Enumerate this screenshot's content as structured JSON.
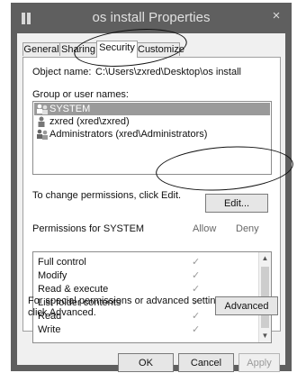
{
  "window": {
    "title": "os install Properties",
    "close_glyph": "×"
  },
  "tabs": [
    {
      "label": "General"
    },
    {
      "label": "Sharing"
    },
    {
      "label": "Security"
    },
    {
      "label": "Customize"
    }
  ],
  "object": {
    "label": "Object name:",
    "value": "C:\\Users\\zxred\\Desktop\\os install"
  },
  "groups": {
    "label": "Group or user names:",
    "users": [
      {
        "name": "SYSTEM"
      },
      {
        "name": "zxred (xred\\zxred)"
      },
      {
        "name": "Administrators (xred\\Administrators)"
      }
    ]
  },
  "change": {
    "text": "To change permissions, click Edit.",
    "edit_label": "Edit..."
  },
  "permissions": {
    "title": "Permissions for SYSTEM",
    "allow_header": "Allow",
    "deny_header": "Deny",
    "rows": [
      {
        "name": "Full control",
        "allow": "✓"
      },
      {
        "name": "Modify",
        "allow": "✓"
      },
      {
        "name": "Read & execute",
        "allow": "✓"
      },
      {
        "name": "List folder contents",
        "allow": "✓"
      },
      {
        "name": "Read",
        "allow": "✓"
      },
      {
        "name": "Write",
        "allow": "✓"
      }
    ]
  },
  "special": {
    "line1": "For special permissions or advanced settings,",
    "line2": "click Advanced.",
    "advanced_label": "Advanced"
  },
  "footer": {
    "ok_label": "OK",
    "cancel_label": "Cancel",
    "apply_label": "Apply"
  },
  "colors": {
    "titlebar": "#5f5f5f",
    "selection": "#9a9a9a",
    "face": "#f0f0f0"
  }
}
